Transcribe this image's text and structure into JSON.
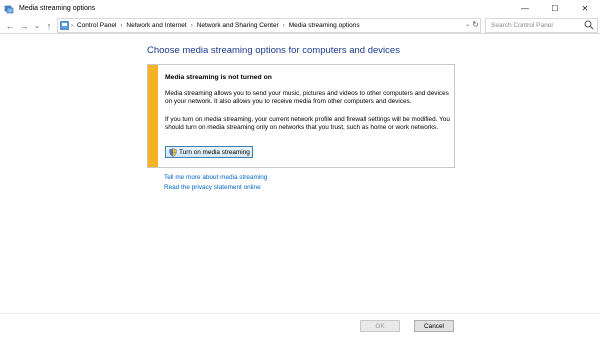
{
  "window": {
    "title": "Media streaming options",
    "minimize_glyph": "—",
    "maximize_glyph": "☐",
    "close_glyph": "✕"
  },
  "nav": {
    "back_glyph": "←",
    "forward_glyph": "→",
    "recent_glyph": "⌄",
    "up_glyph": "↑",
    "breadcrumb": [
      "Control Panel",
      "Network and Internet",
      "Network and Sharing Center",
      "Media streaming options"
    ],
    "separator": "›",
    "dropdown_glyph": "⌄",
    "refresh_glyph": "↻",
    "search_placeholder": "Search Control Panel"
  },
  "main": {
    "heading": "Choose media streaming options for computers and devices",
    "notice": {
      "title": "Media streaming is not turned on",
      "paragraph1": "Media streaming allows you to send your music, pictures and videos to other computers and devices on your network.  It also allows you to receive media from other computers and devices.",
      "paragraph2": "If you turn on media streaming, your current network profile and firewall settings will be modified. You should turn on media streaming only on networks that you trust, such as home or work networks.",
      "button_label": "Turn on media streaming",
      "accent_color": "#f3b223"
    },
    "links": [
      "Tell me more about media streaming",
      "Read the privacy statement online"
    ]
  },
  "footer": {
    "ok_label": "OK",
    "cancel_label": "Cancel"
  },
  "icons": {
    "title": "media-streaming-icon",
    "search": "search-icon",
    "button": "shield-icon"
  }
}
